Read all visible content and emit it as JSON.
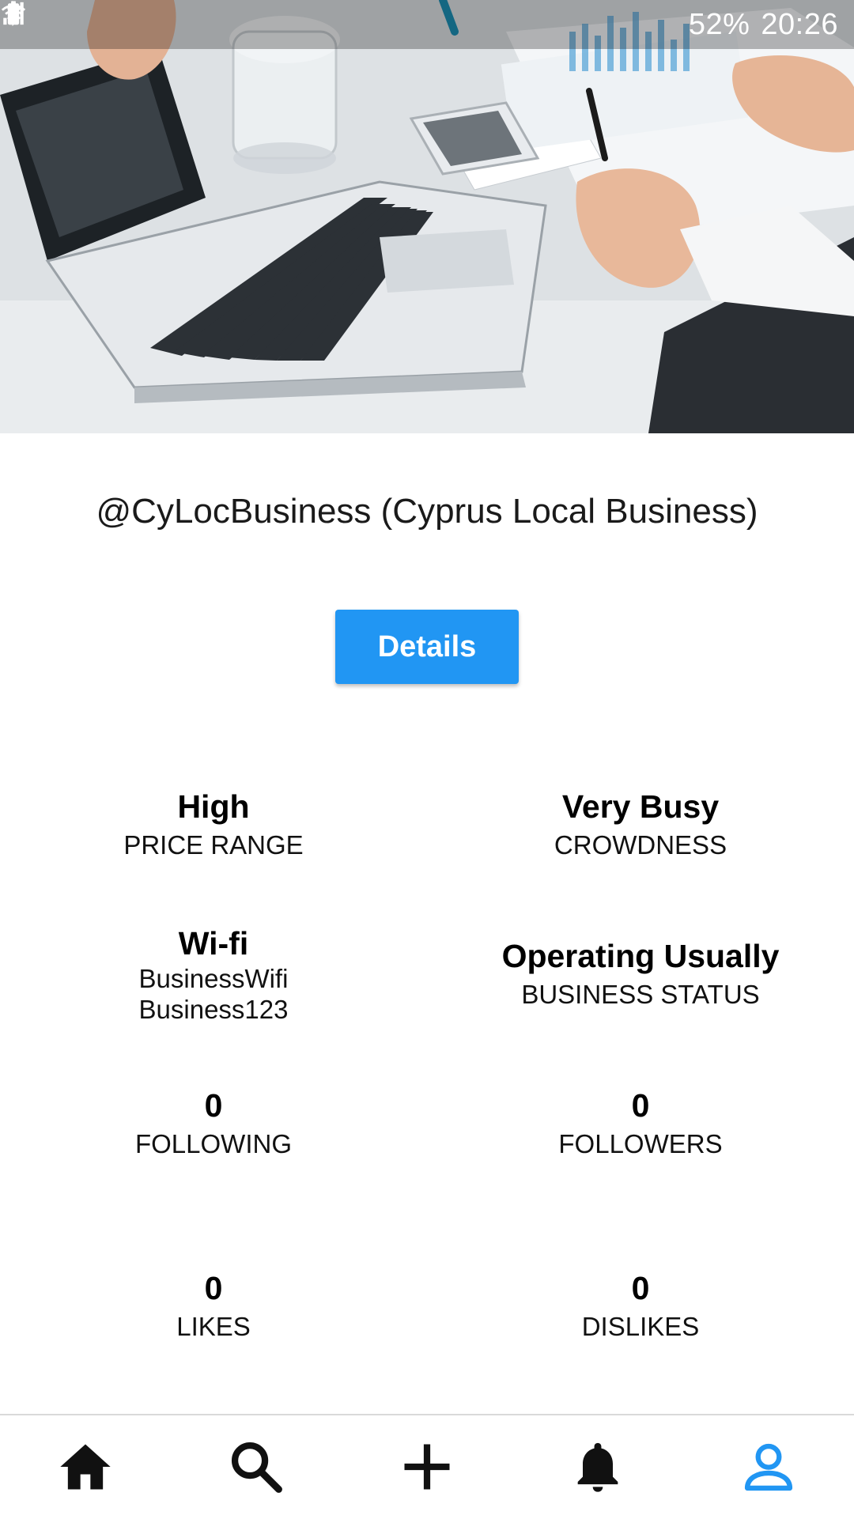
{
  "status_bar": {
    "battery_percent": "52%",
    "time": "20:26",
    "icons": [
      "battery-saver-icon",
      "bluetooth-icon",
      "wifi-icon",
      "signal-icon",
      "battery-icon"
    ]
  },
  "hero": {
    "image_description_icon": "cover-photo"
  },
  "profile": {
    "title": "@CyLocBusiness (Cyprus Local Business)"
  },
  "actions": {
    "details_label": "Details"
  },
  "stats": {
    "price_range": {
      "value": "High",
      "label": "PRICE RANGE"
    },
    "crowdness": {
      "value": "Very Busy",
      "label": "CROWDNESS"
    },
    "wifi": {
      "value": "Wi-fi",
      "ssid": "BusinessWifi",
      "password": "Business123"
    },
    "business_status": {
      "value": "Operating Usually",
      "label": "BUSINESS STATUS"
    },
    "following": {
      "value": "0",
      "label": "FOLLOWING"
    },
    "followers": {
      "value": "0",
      "label": "FOLLOWERS"
    },
    "likes": {
      "value": "0",
      "label": "LIKES"
    },
    "dislikes": {
      "value": "0",
      "label": "DISLIKES"
    }
  },
  "bottom_nav": {
    "items": [
      {
        "name": "home",
        "icon": "home-icon",
        "active": false
      },
      {
        "name": "search",
        "icon": "search-icon",
        "active": false
      },
      {
        "name": "add",
        "icon": "plus-icon",
        "active": false
      },
      {
        "name": "notifications",
        "icon": "bell-icon",
        "active": false
      },
      {
        "name": "profile",
        "icon": "person-icon",
        "active": true
      }
    ],
    "active_color": "#2196f3",
    "inactive_color": "#111111"
  },
  "colors": {
    "accent": "#2196f3"
  }
}
